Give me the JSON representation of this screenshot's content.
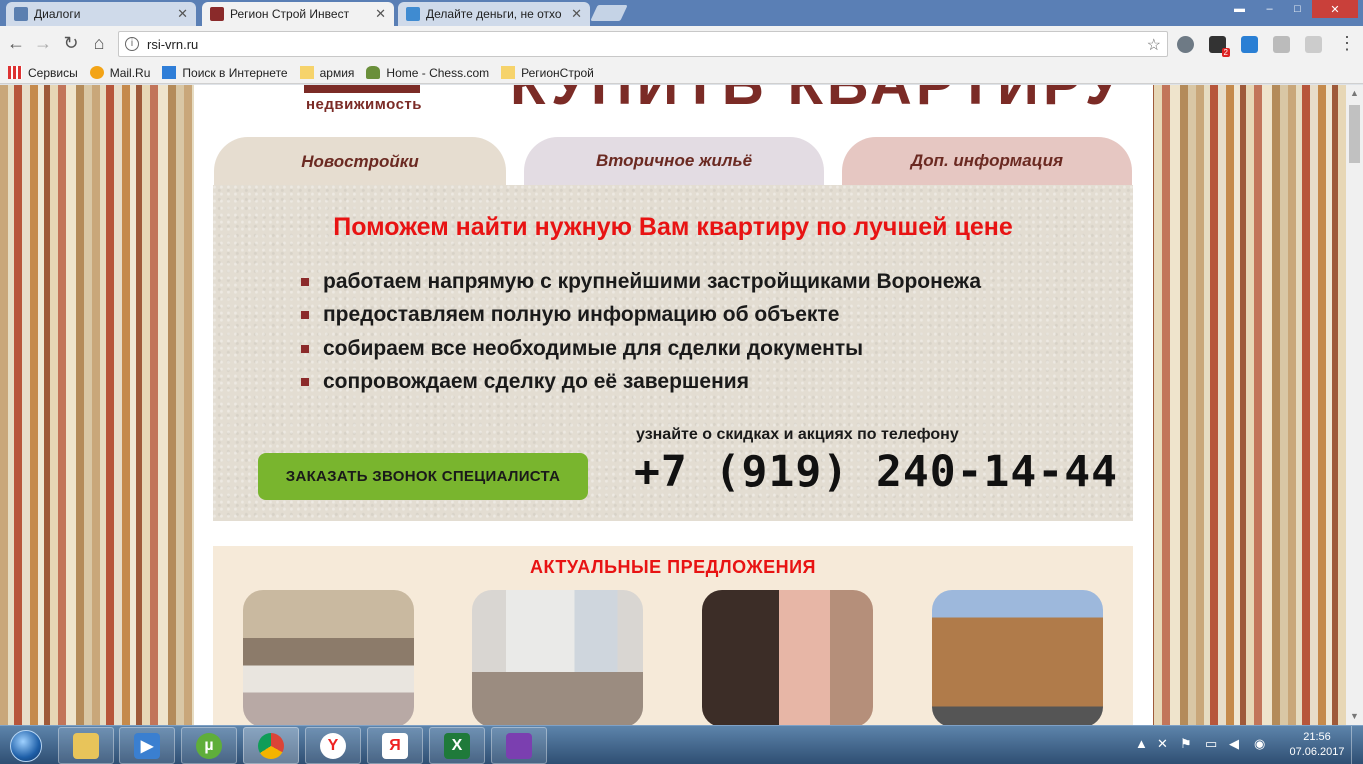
{
  "browser": {
    "tabs": [
      {
        "title": "Диалоги",
        "active": false,
        "icon": "vk-icon"
      },
      {
        "title": "Регион Строй Инвест",
        "active": true,
        "icon": "site-icon"
      },
      {
        "title": "Делайте деньги, не отхо",
        "active": false,
        "icon": "doc-icon"
      }
    ],
    "url": "rsi-vrn.ru",
    "bookmarks": [
      "Сервисы",
      "Mail.Ru",
      "Поиск в Интернете",
      "армия",
      "Home - Chess.com",
      "РегионСтрой"
    ],
    "extension_badge": "2"
  },
  "site": {
    "logo_text": "недвижимость",
    "header_big": "КУПИТЬ КВАРТИРУ",
    "tabs": [
      "Новостройки",
      "Вторичное жильё",
      "Доп. информация"
    ],
    "headline": "Поможем найти нужную Вам квартиру по лучшей цене",
    "features": [
      "работаем напрямую с крупнейшими застройщиками Воронежа",
      "предоставляем полную информацию об объекте",
      "собираем все необходимые для сделки документы",
      "сопровождаем сделку до её завершения"
    ],
    "cta_button": "ЗАКАЗАТЬ ЗВОНОК СПЕЦИАЛИСТА",
    "phone_note": "узнайте о скидках и акциях по телефону",
    "phone": "+7 (919) 240-14-44",
    "offers_title": "АКТУАЛЬНЫЕ ПРЕДЛОЖЕНИЯ"
  },
  "taskbar": {
    "time": "21:56",
    "date": "07.06.2017"
  },
  "colors": {
    "headline_red": "#e81313",
    "brand_maroon": "#7b2b26",
    "cta_green": "#79b52e"
  }
}
